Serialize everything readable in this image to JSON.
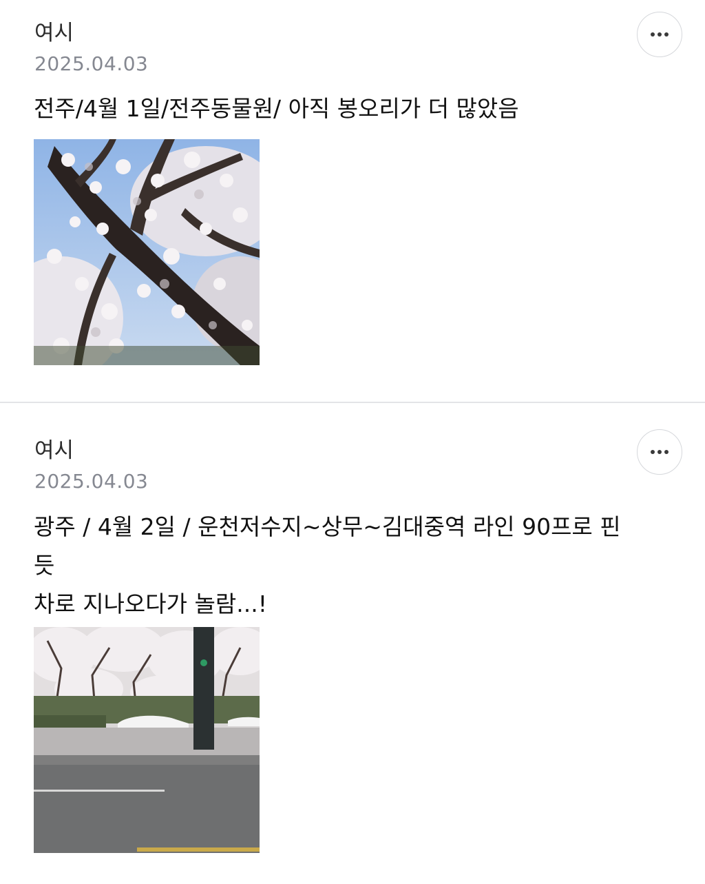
{
  "posts": [
    {
      "author": "여시",
      "date": "2025.04.03",
      "content": "전주/4월 1일/전주동물원/ 아직 봉오리가 더 많았음",
      "image_alt": "cherry-blossom-tree-photo"
    },
    {
      "author": "여시",
      "date": "2025.04.03",
      "content": "광주 / 4월 2일 / 운천저수지~상무~김대중역 라인 90프로 핀\n듯\n차로 지나오다가 놀람...!",
      "image_alt": "cherry-blossom-street-photo"
    }
  ],
  "icons": {
    "more": "more-horizontal-icon"
  },
  "colors": {
    "date": "#858891",
    "divider": "#e3e4e7",
    "button_border": "#d5d7db"
  }
}
